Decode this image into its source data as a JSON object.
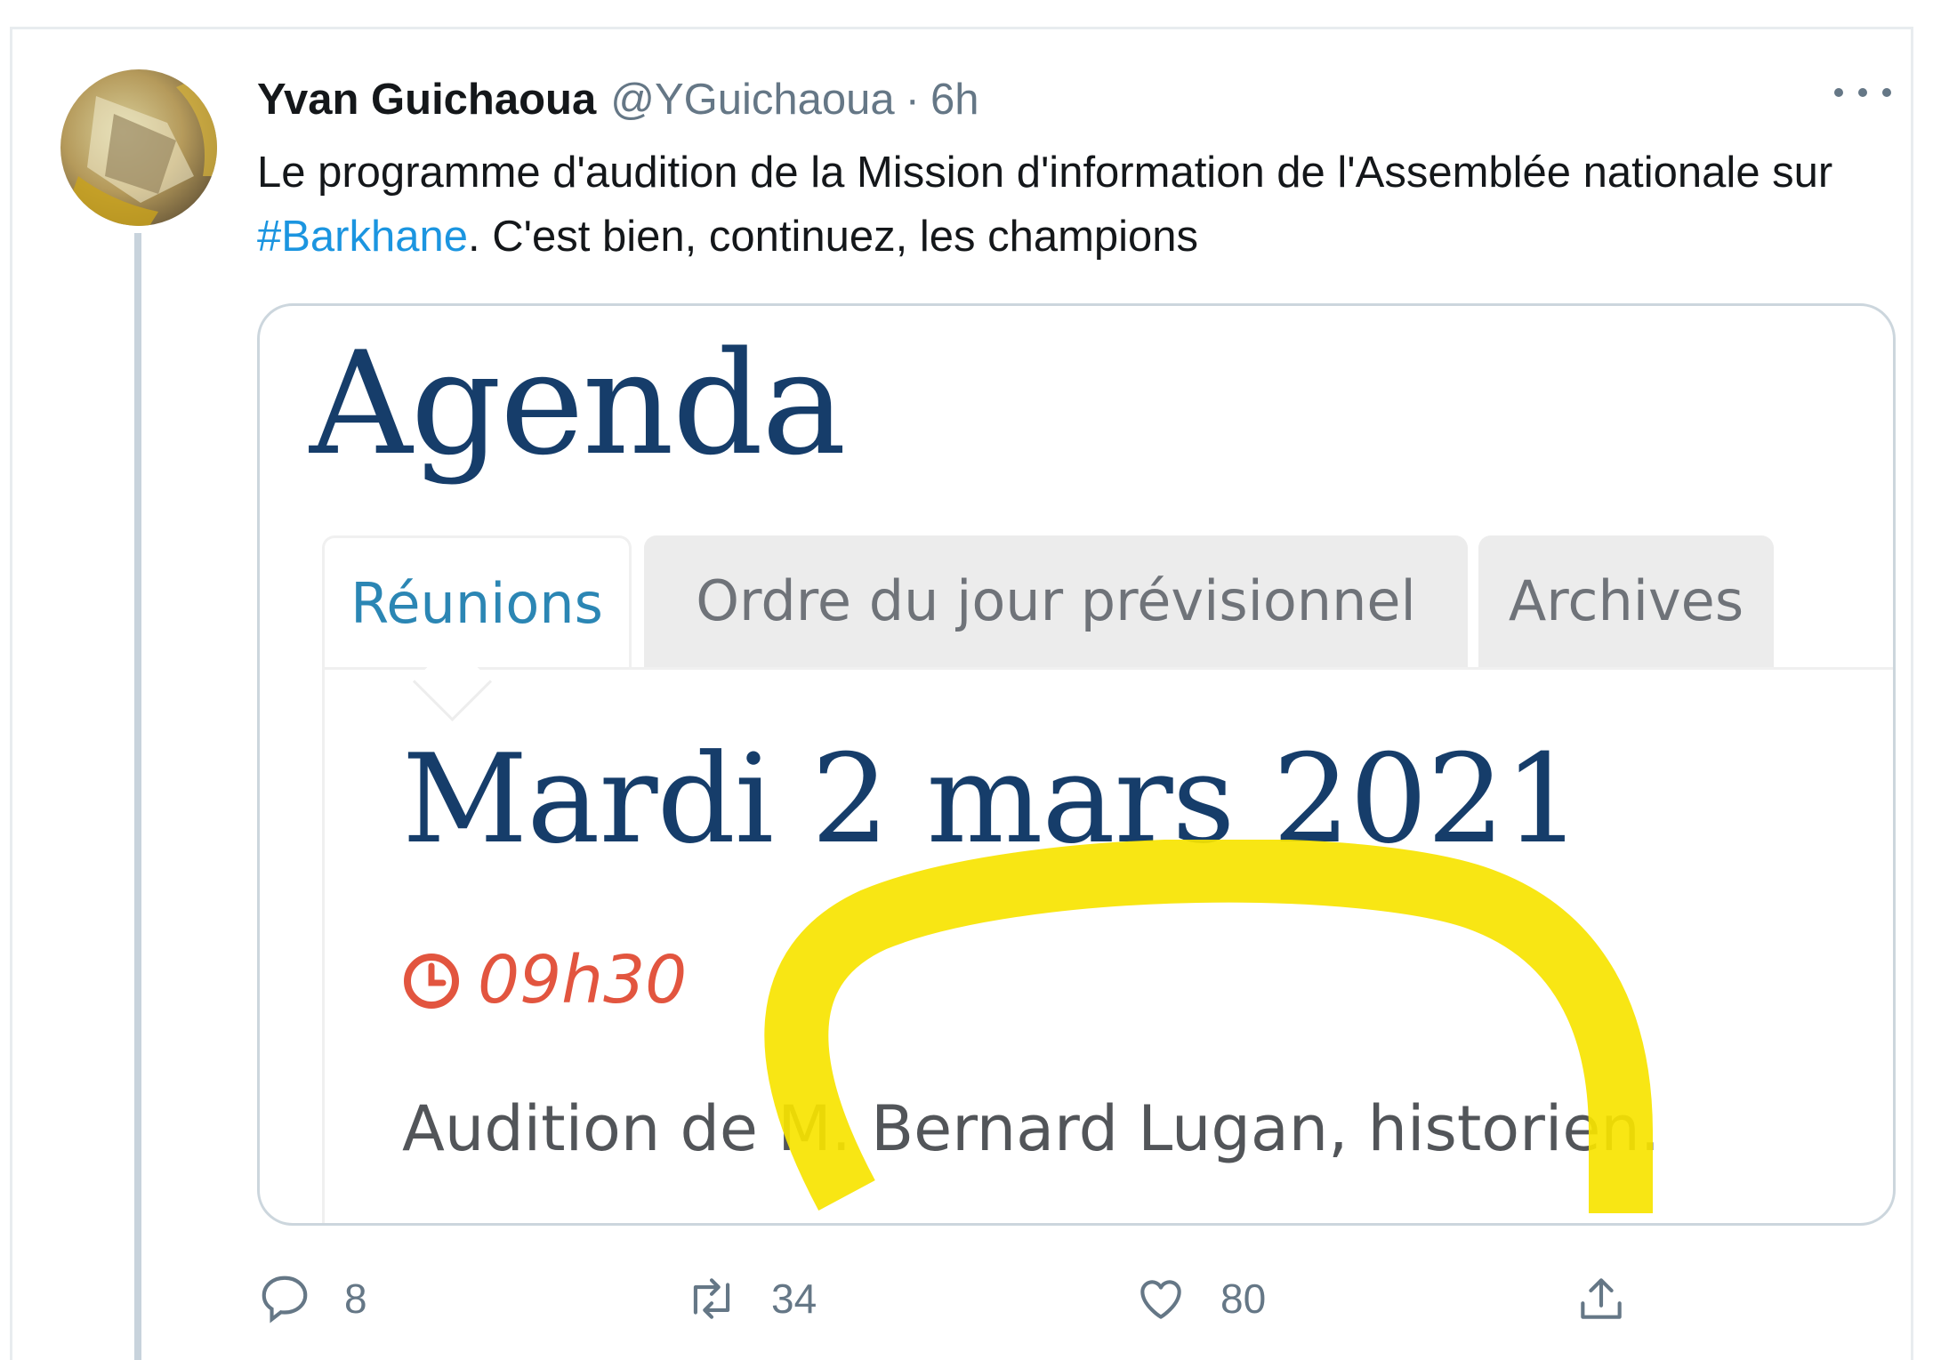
{
  "tweet": {
    "author_name": "Yvan Guichaoua",
    "handle": "@YGuichaoua",
    "separator": "·",
    "time": "6h",
    "text_before": "Le programme d'audition de la Mission d'information de l'Assemblée nationale sur ",
    "hashtag": "#Barkhane",
    "text_after": ". C'est bien, continuez, les champions"
  },
  "image": {
    "title": "Agenda",
    "tabs": [
      "Réunions",
      "Ordre du jour prévisionnel",
      "Archives"
    ],
    "active_tab": "Réunions",
    "date": "Mardi 2 mars 2021",
    "time": "09h30",
    "item": "Audition de M. Bernard Lugan, historien.",
    "highlight_color": "#f7e400"
  },
  "actions": {
    "reply_count": "8",
    "retweet_count": "34",
    "like_count": "80"
  },
  "icons": [
    "more-icon",
    "reply-icon",
    "retweet-icon",
    "like-icon",
    "share-icon",
    "clock-icon"
  ],
  "colors": {
    "link": "#1b95e0",
    "secondary_text": "#657786",
    "agenda_blue": "#163d6a",
    "active_tab": "#2b86b4",
    "clock_red": "#e2553f"
  }
}
